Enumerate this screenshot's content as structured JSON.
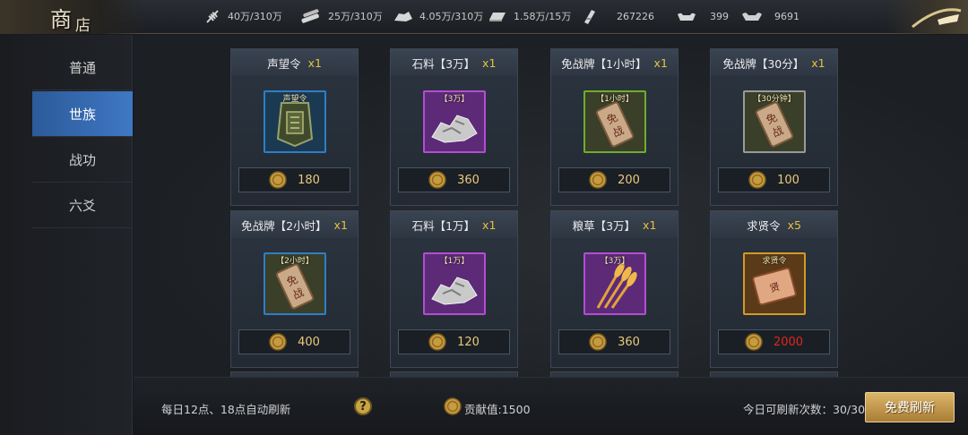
{
  "header": {
    "title_big": "商",
    "title_small": "店",
    "resources": [
      {
        "icon": "grain-icon",
        "value": "40万/310万"
      },
      {
        "icon": "wood-icon",
        "value": "25万/310万"
      },
      {
        "icon": "stone-icon",
        "value": "4.05万/310万"
      },
      {
        "icon": "iron-icon",
        "value": "1.58万/15万"
      },
      {
        "icon": "token-icon",
        "value": "267226"
      },
      {
        "icon": "gold-ingot-icon",
        "value": "399"
      },
      {
        "icon": "silver-ingot-icon",
        "value": "9691"
      }
    ]
  },
  "sidebar": {
    "items": [
      {
        "label": "普通",
        "active": false
      },
      {
        "label": "世族",
        "active": true
      },
      {
        "label": "战功",
        "active": false
      },
      {
        "label": "六爻",
        "active": false
      }
    ]
  },
  "items": [
    {
      "name": "声望令",
      "qty": "x1",
      "tag": "声望令",
      "price": "180",
      "icon": "reputation-token-icon",
      "frame": "#2f7ec7",
      "affordable": true
    },
    {
      "name": "石料【3万】",
      "qty": "x1",
      "tag": "【3万】",
      "price": "360",
      "icon": "stone-pile-icon",
      "frame": "#b14fd1",
      "affordable": true
    },
    {
      "name": "免战牌【1小时】",
      "qty": "x1",
      "tag": "【1小时】",
      "price": "200",
      "icon": "truce-plaque-icon",
      "frame": "#6fae2c",
      "affordable": true
    },
    {
      "name": "免战牌【30分】",
      "qty": "x1",
      "tag": "【30分钟】",
      "price": "100",
      "icon": "truce-plaque-icon",
      "frame": "#9a9a9a",
      "affordable": true
    },
    {
      "name": "免战牌【2小时】",
      "qty": "x1",
      "tag": "【2小时】",
      "price": "400",
      "icon": "truce-plaque-icon",
      "frame": "#2f7ec7",
      "affordable": true
    },
    {
      "name": "石料【1万】",
      "qty": "x1",
      "tag": "【1万】",
      "price": "120",
      "icon": "stone-pile-icon",
      "frame": "#b14fd1",
      "affordable": true
    },
    {
      "name": "粮草【3万】",
      "qty": "x1",
      "tag": "【3万】",
      "price": "360",
      "icon": "wheat-icon",
      "frame": "#b14fd1",
      "affordable": true
    },
    {
      "name": "求贤令",
      "qty": "x5",
      "tag": "求贤令",
      "price": "2000",
      "icon": "recruit-scroll-icon",
      "frame": "#d19a2a",
      "affordable": false
    }
  ],
  "footer": {
    "refresh_note": "每日12点、18点自动刷新",
    "contribution": "贡献值:1500",
    "refresh_count_label": "今日可刷新次数：30/30",
    "refresh_button": "免费刷新"
  },
  "colors": {
    "accent_blue": "#3f78c4",
    "price_gold": "#e9c97a",
    "price_red": "#e0251c",
    "button_gold": "#dcb56a"
  }
}
